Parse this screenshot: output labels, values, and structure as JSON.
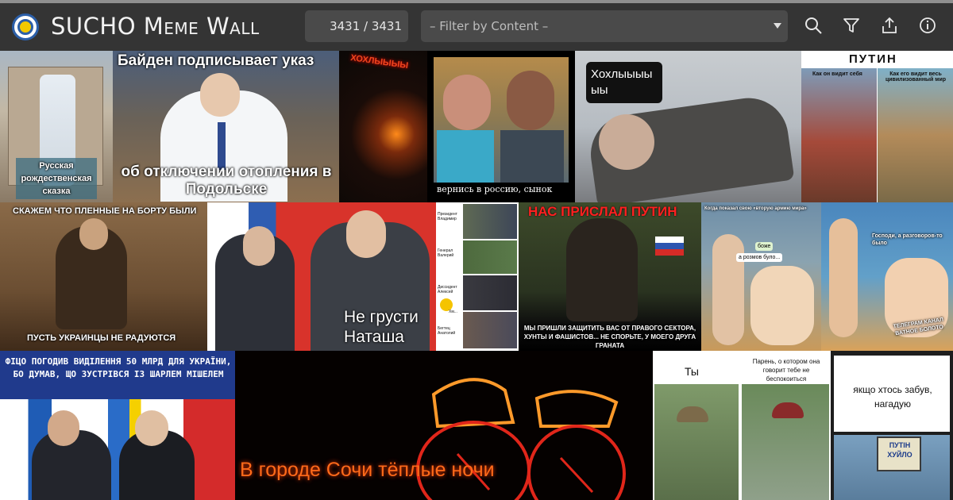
{
  "app": {
    "title": "SUCHO Meme Wall"
  },
  "header": {
    "counter": "3431 / 3431",
    "filter_placeholder": "– Filter by Content –",
    "icons": [
      "search-icon",
      "filter-icon",
      "share-icon",
      "info-icon"
    ]
  },
  "memes": {
    "m1": "Русская рождественская сказка",
    "m2_top": "Байден подписывает указ",
    "m2_bottom": "об отключении отопления в Подольске",
    "m3": "ХОХЛЫЫЫЫ",
    "m4": "вернись в россию, сынок",
    "m5": "Хохлыыыы ыы",
    "m6_title": "ПУТИН",
    "m6_left": "Как он видит себя",
    "m6_right": "Как его видит весь цивилизованный мир",
    "m7_top": "СКАЖЕМ ЧТО ПЛЕННЫЕ НА БОРТУ БЫЛИ",
    "m7_bottom": "ПУСТЬ УКРАИНЦЫ НЕ РАДУЮТСЯ",
    "m8": "Не грусти Наташа",
    "m9_labels": [
      "Президент Владимир",
      "Генерал Валерий",
      "Диссидент Алексей",
      "Хм...",
      "Бегтец Анатолий"
    ],
    "m10_top": "НАС ПРИСЛАЛ ПУТИН",
    "m10_bottom": "МЫ ПРИШЛИ ЗАЩИТИТЬ ВАС ОТ ПРАВОГО СЕКТОРА, ХУНТЫ И ФАШИСТОВ... НЕ СПОРЬТЕ, У МОЕГО ДРУГА ГРАНАТА",
    "m11_top": "Когда показал свою «вторую армию мира»",
    "m11_b1": "боже",
    "m11_b2": "а розмов було...",
    "m12_top": "Господи, а разговоров-то было",
    "m12_bottom": "ТЕЛЕГРАМ КАНАЛ ВАТНОЕ БОЛОТО",
    "m13": "ФІЦО ПОГОДИВ ВИДІЛЕННЯ 50 МЛРД ДЛЯ УКРАЇНИ, БО ДУМАВ, ЩО ЗУСТРІВСЯ ІЗ ШАРЛЕМ МІШЕЛЕМ",
    "m14": "В городе Сочи тёплые ночи",
    "m15_left": "Ты",
    "m15_right": "Парень, о котором она говорит тебе не беспокоиться",
    "m16_top": "якщо хтось забув, нагадую",
    "m16_sign": "ПУТІН ХУЙЛО"
  },
  "colors": {
    "header_bg": "#343434",
    "control_bg": "#4a4a4a",
    "accent_blue": "#2c5fa8",
    "banner_blue": "#203a8c",
    "neon_orange": "#ff8a1c"
  }
}
